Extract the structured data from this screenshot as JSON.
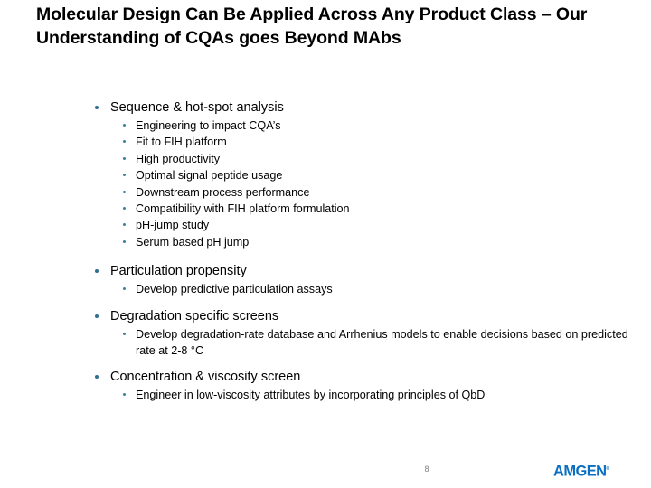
{
  "slide": {
    "title": "Molecular Design Can Be Applied Across Any Product Class – Our Understanding of CQAs goes Beyond MAbs",
    "page_number": "8",
    "logo_text": "AMGEN",
    "logo_tm": "®",
    "colors": {
      "rule": "#2e6b7c",
      "bullet_level1": "#2f6f8f",
      "bullet_level2": "#3d7fa0",
      "logo": "#0a6fc2",
      "page_number": "#808080",
      "background": "#ffffff",
      "text": "#000000"
    }
  },
  "content": {
    "groups": [
      {
        "heading": "Sequence & hot-spot analysis",
        "items": [
          "Engineering to impact CQA’s",
          "Fit to FIH platform",
          "High productivity",
          "Optimal signal peptide usage",
          "Downstream process performance",
          "Compatibility with FIH platform formulation",
          "pH-jump study",
          "Serum based pH jump"
        ]
      },
      {
        "heading": "Particulation propensity",
        "items": [
          "Develop predictive particulation assays"
        ]
      },
      {
        "heading": "Degradation specific screens",
        "items": [
          "Develop degradation-rate database and Arrhenius models to enable decisions based on predicted rate at 2-8 °C"
        ]
      },
      {
        "heading": "Concentration & viscosity screen",
        "items": [
          "Engineer in low-viscosity attributes by incorporating principles of QbD"
        ]
      }
    ]
  }
}
